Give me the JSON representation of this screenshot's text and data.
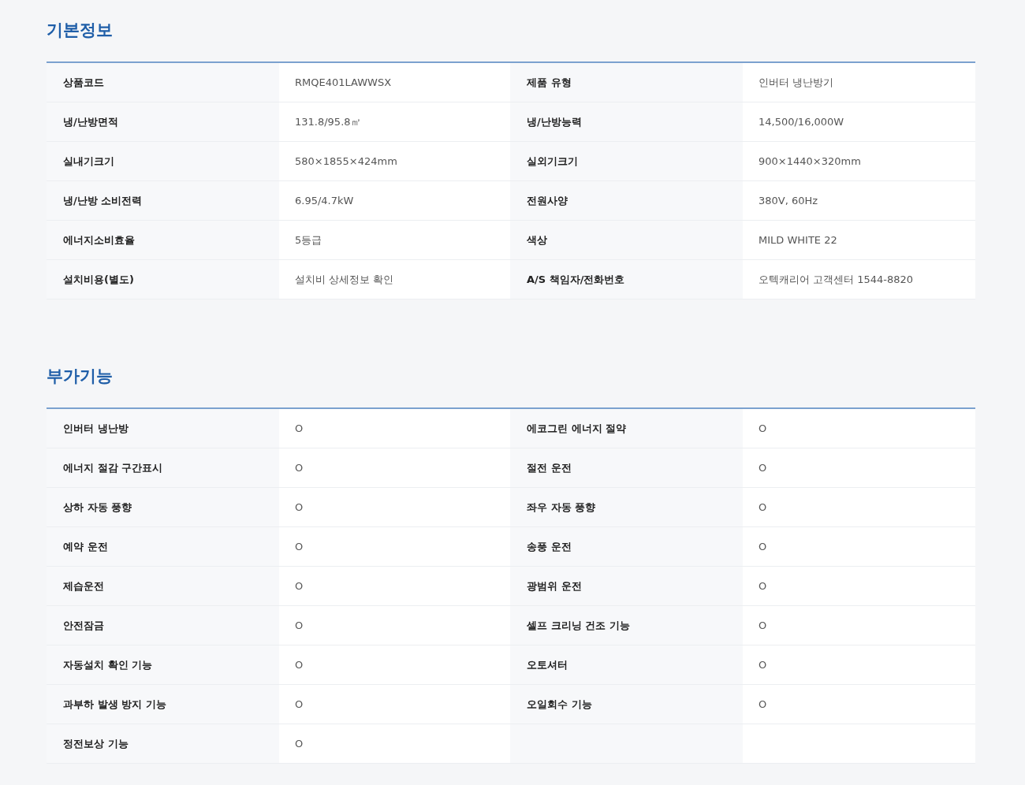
{
  "sections": [
    {
      "title": "기본정보",
      "rows": [
        [
          {
            "label": "상품코드",
            "value": "RMQE401LAWWSX"
          },
          {
            "label": "제품 유형",
            "value": "인버터 냉난방기"
          }
        ],
        [
          {
            "label": "냉/난방면적",
            "value": "131.8/95.8㎡"
          },
          {
            "label": "냉/난방능력",
            "value": "14,500/16,000W"
          }
        ],
        [
          {
            "label": "실내기크기",
            "value": "580×1855×424mm"
          },
          {
            "label": "실외기크기",
            "value": "900×1440×320mm"
          }
        ],
        [
          {
            "label": "냉/난방 소비전력",
            "value": "6.95/4.7kW"
          },
          {
            "label": "전원사양",
            "value": "380V, 60Hz"
          }
        ],
        [
          {
            "label": "에너지소비효율",
            "value": "5등급"
          },
          {
            "label": "색상",
            "value": "MILD WHITE 22"
          }
        ],
        [
          {
            "label": "설치비용(별도)",
            "value": "설치비 상세정보 확인"
          },
          {
            "label": "A/S 책임자/전화번호",
            "value": "오텍캐리어 고객센터 1544-8820"
          }
        ]
      ]
    },
    {
      "title": "부가기능",
      "rows": [
        [
          {
            "label": "인버터 냉난방",
            "value": "O"
          },
          {
            "label": "에코그린 에너지 절약",
            "value": "O"
          }
        ],
        [
          {
            "label": "에너지 절감 구간표시",
            "value": "O"
          },
          {
            "label": "절전 운전",
            "value": "O"
          }
        ],
        [
          {
            "label": "상하 자동 풍향",
            "value": "O"
          },
          {
            "label": "좌우 자동 풍향",
            "value": "O"
          }
        ],
        [
          {
            "label": "예약 운전",
            "value": "O"
          },
          {
            "label": "송풍 운전",
            "value": "O"
          }
        ],
        [
          {
            "label": "제습운전",
            "value": "O"
          },
          {
            "label": "광범위 운전",
            "value": "O"
          }
        ],
        [
          {
            "label": "안전잠금",
            "value": "O"
          },
          {
            "label": "셀프 크리닝 건조 기능",
            "value": "O"
          }
        ],
        [
          {
            "label": "자동설치 확인 기능",
            "value": "O"
          },
          {
            "label": "오토셔터",
            "value": "O"
          }
        ],
        [
          {
            "label": "과부하 발생 방지 기능",
            "value": "O"
          },
          {
            "label": "오일회수 기능",
            "value": "O"
          }
        ],
        [
          {
            "label": "정전보상 기능",
            "value": "O"
          }
        ]
      ]
    }
  ]
}
